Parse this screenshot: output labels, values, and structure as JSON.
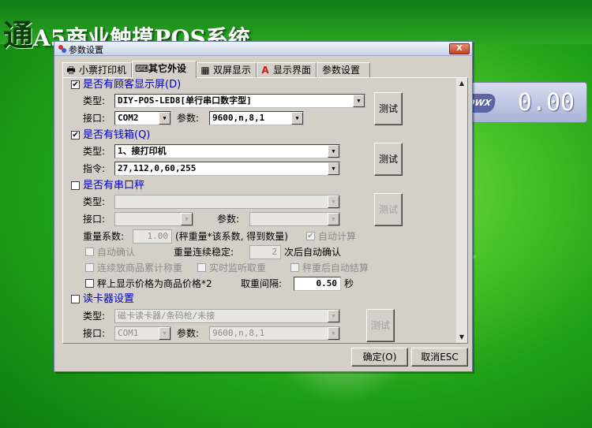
{
  "app": {
    "brand": "通",
    "title": "A5商业触摸POS系统"
  },
  "customer_display": {
    "logo": "QWX",
    "value": "0.00"
  },
  "dialog": {
    "title": "参数设置",
    "close": "X",
    "tabs": [
      {
        "label": "小票打印机",
        "icon": "printer-icon"
      },
      {
        "label": "其它外设",
        "icon": "device-icon",
        "active": true
      },
      {
        "label": "双屏显示",
        "icon": "dual-screen-icon"
      },
      {
        "label": "显示界面",
        "icon": "font-icon"
      },
      {
        "label": "参数设置",
        "icon": ""
      }
    ],
    "customer_display_section": {
      "checked": true,
      "label": "是否有顾客显示屏(D)",
      "type_label": "类型:",
      "type_value": "DIY-POS-LED8[单行串口数字型]",
      "port_label": "接口:",
      "port_value": "COM2",
      "param_label": "参数:",
      "param_value": "9600,n,8,1",
      "test_label": "测试"
    },
    "cash_drawer_section": {
      "checked": true,
      "label": "是否有钱箱(Q)",
      "type_label": "类型:",
      "type_value": "1、接打印机",
      "cmd_label": "指令:",
      "cmd_value": "27,112,0,60,255",
      "test_label": "测试"
    },
    "scale_section": {
      "checked": false,
      "label": "是否有串口秤",
      "type_label": "类型:",
      "type_value": "",
      "port_label": "接口:",
      "port_value": "",
      "param_label": "参数:",
      "param_value": "",
      "test_label": "测试",
      "coef_label": "重量系数:",
      "coef_value": "1.00",
      "coef_note": "(秤重量*该系数, 得到数量)",
      "auto_calc_label": "自动计算",
      "auto_confirm_label": "自动确认",
      "stable_label": "重量连续稳定:",
      "stable_value": "2",
      "stable_after": "次后自动确认",
      "continuous_label": "连续放商品累计称重",
      "realtime_label": "实时监听取重",
      "after_weigh_label": "秤重后自动结算",
      "price_x2_label": "秤上显示价格为商品价格*2",
      "interval_label": "取重间隔:",
      "interval_value": "0.50",
      "interval_unit": "秒"
    },
    "card_reader_section": {
      "checked": false,
      "label": "读卡器设置",
      "type_label": "类型:",
      "type_value": "磁卡读卡器/条码枪/未接",
      "port_label": "接口:",
      "port_value": "COM1",
      "param_label": "参数:",
      "param_value": "9600,n,8,1",
      "test_label": "测试"
    },
    "ok_label": "确定(O)",
    "cancel_label": "取消ESC"
  }
}
